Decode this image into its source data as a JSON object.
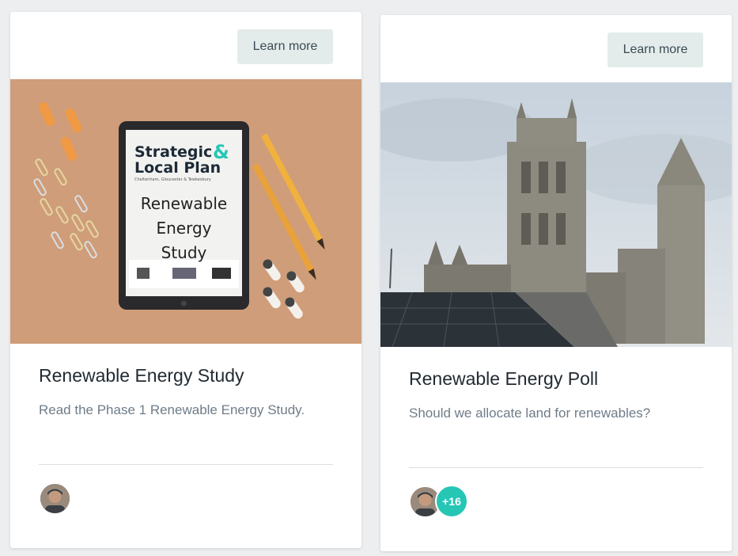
{
  "cards": [
    {
      "button_label": "Learn more",
      "image_text": {
        "line1": "Strategic",
        "amp": "&",
        "line2": "Local Plan",
        "subtitle": "Cheltenham, Gloucester & Tewkesbury",
        "study_l1": "Renewable",
        "study_l2": "Energy",
        "study_l3": "Study"
      },
      "title": "Renewable Energy Study",
      "description": "Read the Phase 1 Renewable Energy Study."
    },
    {
      "button_label": "Learn more",
      "title": "Renewable Energy Poll",
      "description": "Should we allocate land for renewables?",
      "participants_more": "+16"
    }
  ],
  "colors": {
    "button_bg": "#e3ecea",
    "badge": "#26c6b5",
    "accent_amp": "#26c6b5"
  }
}
